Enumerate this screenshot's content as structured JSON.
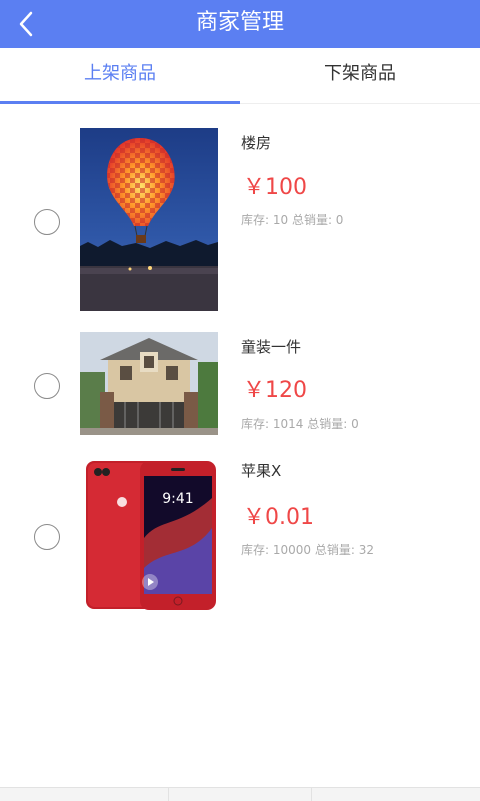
{
  "header": {
    "title": "商家管理"
  },
  "tabs": [
    {
      "label": "上架商品",
      "active": true
    },
    {
      "label": "下架商品",
      "active": false
    }
  ],
  "products": [
    {
      "name": "楼房",
      "price": "￥100",
      "stock_text": "库存: 10 总销量: 0",
      "image": "hot-air-balloon-photo"
    },
    {
      "name": "童装一件",
      "price": "￥120",
      "stock_text": "库存: 1014 总销量: 0",
      "image": "villa-house-photo"
    },
    {
      "name": "苹果X",
      "price": "￥0.01",
      "stock_text": "库存: 10000 总销量: 32",
      "image": "red-iphone-photo"
    }
  ],
  "phone_screen": {
    "time": "9:41"
  },
  "colors": {
    "accent": "#5b7ff2",
    "price": "#ef4747"
  }
}
